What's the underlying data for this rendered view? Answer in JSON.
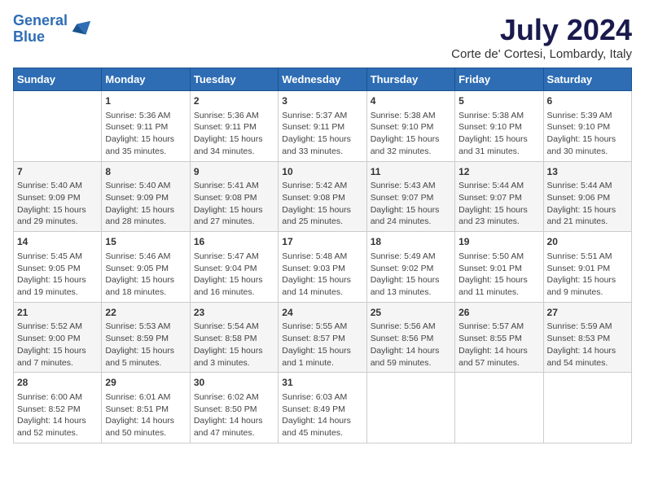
{
  "logo": {
    "line1": "General",
    "line2": "Blue"
  },
  "title": "July 2024",
  "subtitle": "Corte de' Cortesi, Lombardy, Italy",
  "headers": [
    "Sunday",
    "Monday",
    "Tuesday",
    "Wednesday",
    "Thursday",
    "Friday",
    "Saturday"
  ],
  "weeks": [
    [
      {
        "day": "",
        "content": ""
      },
      {
        "day": "1",
        "content": "Sunrise: 5:36 AM\nSunset: 9:11 PM\nDaylight: 15 hours\nand 35 minutes."
      },
      {
        "day": "2",
        "content": "Sunrise: 5:36 AM\nSunset: 9:11 PM\nDaylight: 15 hours\nand 34 minutes."
      },
      {
        "day": "3",
        "content": "Sunrise: 5:37 AM\nSunset: 9:11 PM\nDaylight: 15 hours\nand 33 minutes."
      },
      {
        "day": "4",
        "content": "Sunrise: 5:38 AM\nSunset: 9:10 PM\nDaylight: 15 hours\nand 32 minutes."
      },
      {
        "day": "5",
        "content": "Sunrise: 5:38 AM\nSunset: 9:10 PM\nDaylight: 15 hours\nand 31 minutes."
      },
      {
        "day": "6",
        "content": "Sunrise: 5:39 AM\nSunset: 9:10 PM\nDaylight: 15 hours\nand 30 minutes."
      }
    ],
    [
      {
        "day": "7",
        "content": "Sunrise: 5:40 AM\nSunset: 9:09 PM\nDaylight: 15 hours\nand 29 minutes."
      },
      {
        "day": "8",
        "content": "Sunrise: 5:40 AM\nSunset: 9:09 PM\nDaylight: 15 hours\nand 28 minutes."
      },
      {
        "day": "9",
        "content": "Sunrise: 5:41 AM\nSunset: 9:08 PM\nDaylight: 15 hours\nand 27 minutes."
      },
      {
        "day": "10",
        "content": "Sunrise: 5:42 AM\nSunset: 9:08 PM\nDaylight: 15 hours\nand 25 minutes."
      },
      {
        "day": "11",
        "content": "Sunrise: 5:43 AM\nSunset: 9:07 PM\nDaylight: 15 hours\nand 24 minutes."
      },
      {
        "day": "12",
        "content": "Sunrise: 5:44 AM\nSunset: 9:07 PM\nDaylight: 15 hours\nand 23 minutes."
      },
      {
        "day": "13",
        "content": "Sunrise: 5:44 AM\nSunset: 9:06 PM\nDaylight: 15 hours\nand 21 minutes."
      }
    ],
    [
      {
        "day": "14",
        "content": "Sunrise: 5:45 AM\nSunset: 9:05 PM\nDaylight: 15 hours\nand 19 minutes."
      },
      {
        "day": "15",
        "content": "Sunrise: 5:46 AM\nSunset: 9:05 PM\nDaylight: 15 hours\nand 18 minutes."
      },
      {
        "day": "16",
        "content": "Sunrise: 5:47 AM\nSunset: 9:04 PM\nDaylight: 15 hours\nand 16 minutes."
      },
      {
        "day": "17",
        "content": "Sunrise: 5:48 AM\nSunset: 9:03 PM\nDaylight: 15 hours\nand 14 minutes."
      },
      {
        "day": "18",
        "content": "Sunrise: 5:49 AM\nSunset: 9:02 PM\nDaylight: 15 hours\nand 13 minutes."
      },
      {
        "day": "19",
        "content": "Sunrise: 5:50 AM\nSunset: 9:01 PM\nDaylight: 15 hours\nand 11 minutes."
      },
      {
        "day": "20",
        "content": "Sunrise: 5:51 AM\nSunset: 9:01 PM\nDaylight: 15 hours\nand 9 minutes."
      }
    ],
    [
      {
        "day": "21",
        "content": "Sunrise: 5:52 AM\nSunset: 9:00 PM\nDaylight: 15 hours\nand 7 minutes."
      },
      {
        "day": "22",
        "content": "Sunrise: 5:53 AM\nSunset: 8:59 PM\nDaylight: 15 hours\nand 5 minutes."
      },
      {
        "day": "23",
        "content": "Sunrise: 5:54 AM\nSunset: 8:58 PM\nDaylight: 15 hours\nand 3 minutes."
      },
      {
        "day": "24",
        "content": "Sunrise: 5:55 AM\nSunset: 8:57 PM\nDaylight: 15 hours\nand 1 minute."
      },
      {
        "day": "25",
        "content": "Sunrise: 5:56 AM\nSunset: 8:56 PM\nDaylight: 14 hours\nand 59 minutes."
      },
      {
        "day": "26",
        "content": "Sunrise: 5:57 AM\nSunset: 8:55 PM\nDaylight: 14 hours\nand 57 minutes."
      },
      {
        "day": "27",
        "content": "Sunrise: 5:59 AM\nSunset: 8:53 PM\nDaylight: 14 hours\nand 54 minutes."
      }
    ],
    [
      {
        "day": "28",
        "content": "Sunrise: 6:00 AM\nSunset: 8:52 PM\nDaylight: 14 hours\nand 52 minutes."
      },
      {
        "day": "29",
        "content": "Sunrise: 6:01 AM\nSunset: 8:51 PM\nDaylight: 14 hours\nand 50 minutes."
      },
      {
        "day": "30",
        "content": "Sunrise: 6:02 AM\nSunset: 8:50 PM\nDaylight: 14 hours\nand 47 minutes."
      },
      {
        "day": "31",
        "content": "Sunrise: 6:03 AM\nSunset: 8:49 PM\nDaylight: 14 hours\nand 45 minutes."
      },
      {
        "day": "",
        "content": ""
      },
      {
        "day": "",
        "content": ""
      },
      {
        "day": "",
        "content": ""
      }
    ]
  ]
}
